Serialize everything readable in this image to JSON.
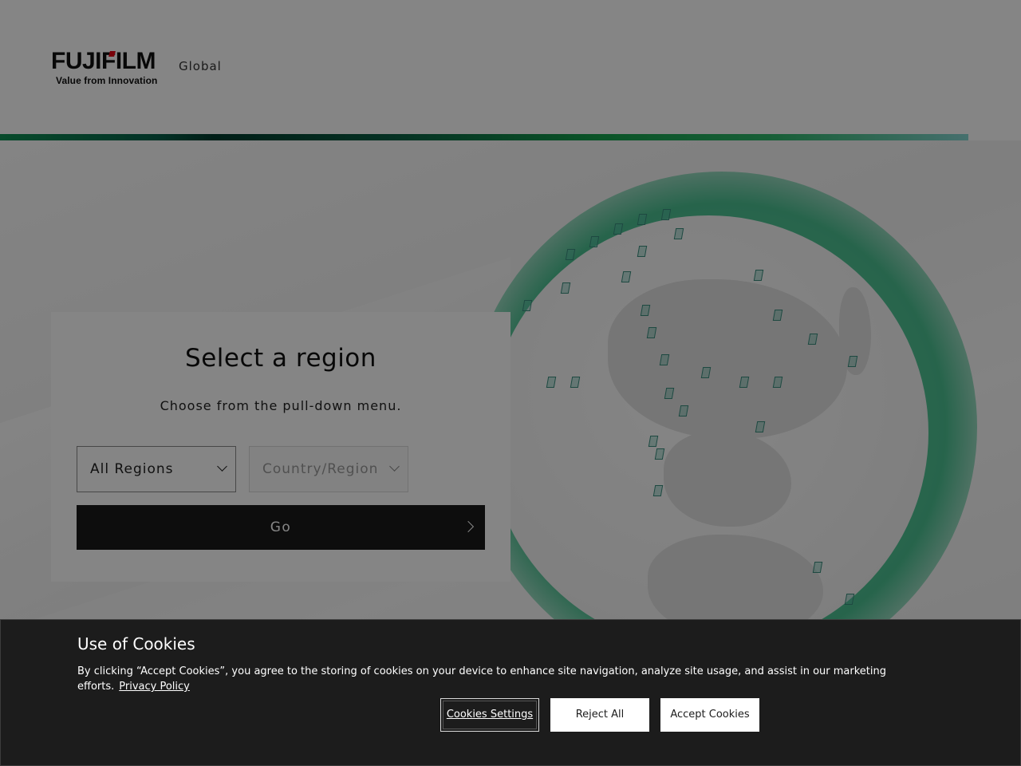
{
  "header": {
    "logo_text": "FUJIFILM",
    "logo_tagline": "Value from Innovation",
    "site_label": "Global"
  },
  "brand_colors": {
    "stripe_start": "#0e8f53",
    "stripe_dark": "#013a2c",
    "stripe_end": "#86d6d2",
    "globe_glow": "#4bc091"
  },
  "region_selector": {
    "title": "Select a region",
    "subtitle": "Choose from the pull-down menu.",
    "region_select": {
      "value": "All Regions",
      "icon": "chevron-down-icon"
    },
    "country_select": {
      "placeholder": "Country/Region",
      "disabled": true,
      "icon": "chevron-down-icon"
    },
    "go_button": {
      "label": "Go",
      "icon": "chevron-right-icon"
    }
  },
  "cookie_banner": {
    "title": "Use of Cookies",
    "text": "By clicking “Accept Cookies”, you agree to the storing of cookies on your device to enhance site navigation, analyze site usage, and assist in our marketing efforts.",
    "privacy_link": "Privacy Policy",
    "settings_button": "Cookies Settings",
    "reject_button": "Reject All",
    "accept_button": "Accept Cookies"
  }
}
